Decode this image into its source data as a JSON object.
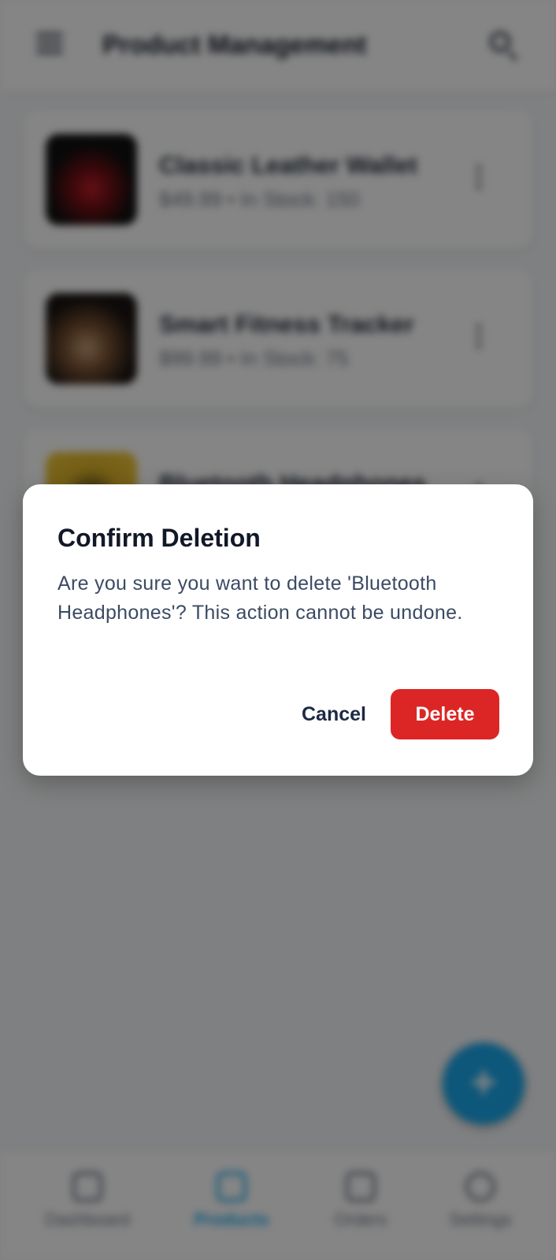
{
  "header": {
    "title": "Product Management",
    "menu_icon": "menu-icon",
    "search_icon": "search-icon"
  },
  "products": [
    {
      "name": "Classic Leather Wallet",
      "meta": "$49.99 • In Stock: 150"
    },
    {
      "name": "Smart Fitness Tracker",
      "meta": "$99.99 • In Stock: 75"
    },
    {
      "name": "Bluetooth Headphones",
      "meta": ""
    }
  ],
  "fab": {
    "icon": "plus-icon",
    "label": "+"
  },
  "bottom_nav": [
    {
      "label": "Dashboard",
      "icon": "dashboard-icon",
      "active": false
    },
    {
      "label": "Products",
      "icon": "products-icon",
      "active": true
    },
    {
      "label": "Orders",
      "icon": "orders-icon",
      "active": false
    },
    {
      "label": "Settings",
      "icon": "settings-icon",
      "active": false
    }
  ],
  "dialog": {
    "title": "Confirm Deletion",
    "message": "Are you sure you want to delete 'Bluetooth Headphones'? This action cannot be undone.",
    "cancel_label": "Cancel",
    "delete_label": "Delete"
  },
  "colors": {
    "accent": "#1aa7ea",
    "danger": "#dc2626",
    "title_text": "#111827",
    "body_text": "#3b4a63"
  }
}
